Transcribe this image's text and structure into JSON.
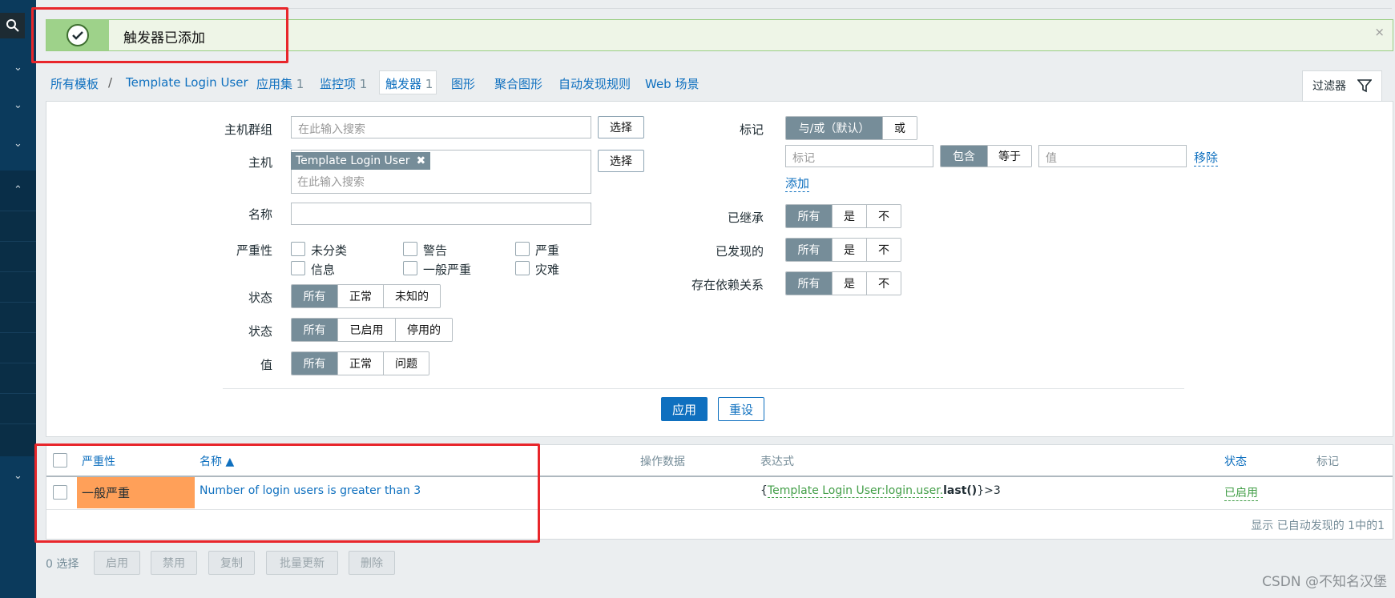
{
  "notification": {
    "text": "触发器已添加",
    "close": "×"
  },
  "breadcrumb": {
    "all_templates": "所有模板",
    "separator": "/",
    "template": "Template Login User"
  },
  "tabs": [
    {
      "label": "应用集",
      "count": "1"
    },
    {
      "label": "监控项",
      "count": "1"
    },
    {
      "label": "触发器",
      "count": "1"
    },
    {
      "label": "图形"
    },
    {
      "label": "聚合图形"
    },
    {
      "label": "自动发现规则"
    },
    {
      "label": "Web 场景"
    }
  ],
  "filter_tab": {
    "label": "过滤器"
  },
  "filter": {
    "host_group": {
      "label": "主机群组",
      "placeholder": "在此输入搜索",
      "select": "选择"
    },
    "host": {
      "label": "主机",
      "tag": "Template Login User",
      "placeholder": "在此输入搜索",
      "select": "选择"
    },
    "name": {
      "label": "名称",
      "value": ""
    },
    "severity": {
      "label": "严重性",
      "options": [
        "未分类",
        "警告",
        "严重",
        "信息",
        "一般严重",
        "灾难"
      ]
    },
    "state": {
      "label": "状态",
      "options": [
        "所有",
        "正常",
        "未知的"
      ]
    },
    "status": {
      "label": "状态",
      "options": [
        "所有",
        "已启用",
        "停用的"
      ]
    },
    "value": {
      "label": "值",
      "options": [
        "所有",
        "正常",
        "问题"
      ]
    },
    "tags": {
      "label": "标记",
      "options": [
        "与/或（默认）",
        "或"
      ],
      "tag_placeholder": "标记",
      "operators": [
        "包含",
        "等于"
      ],
      "value_placeholder": "值",
      "remove": "移除",
      "add": "添加"
    },
    "inherited": {
      "label": "已继承",
      "options": [
        "所有",
        "是",
        "不"
      ]
    },
    "discovered": {
      "label": "已发现的",
      "options": [
        "所有",
        "是",
        "不"
      ]
    },
    "dependencies": {
      "label": "存在依赖关系",
      "options": [
        "所有",
        "是",
        "不"
      ]
    },
    "apply": "应用",
    "reset": "重设"
  },
  "table": {
    "headers": {
      "severity": "严重性",
      "name": "名称 ▲",
      "operational_data": "操作数据",
      "expression": "表达式",
      "status": "状态",
      "tags": "标记"
    },
    "rows": [
      {
        "severity": "一般严重",
        "name": "Number of login users is greater than 3",
        "expr_open": "{",
        "expr_key": "Template Login User:login.user.",
        "expr_fn": "last()",
        "expr_close": "}>3",
        "status": "已启用"
      }
    ],
    "footer": "显示 已自动发现的 1中的1"
  },
  "bulk": {
    "selected": "0 选择",
    "buttons": [
      "启用",
      "禁用",
      "复制",
      "批量更新",
      "删除"
    ]
  },
  "watermark": "CSDN @不知名汉堡",
  "colors": {
    "accent": "#0f70bf",
    "success": "#9ed28a",
    "severity_average": "#ffa059",
    "sidebar": "#0b3a5c"
  }
}
